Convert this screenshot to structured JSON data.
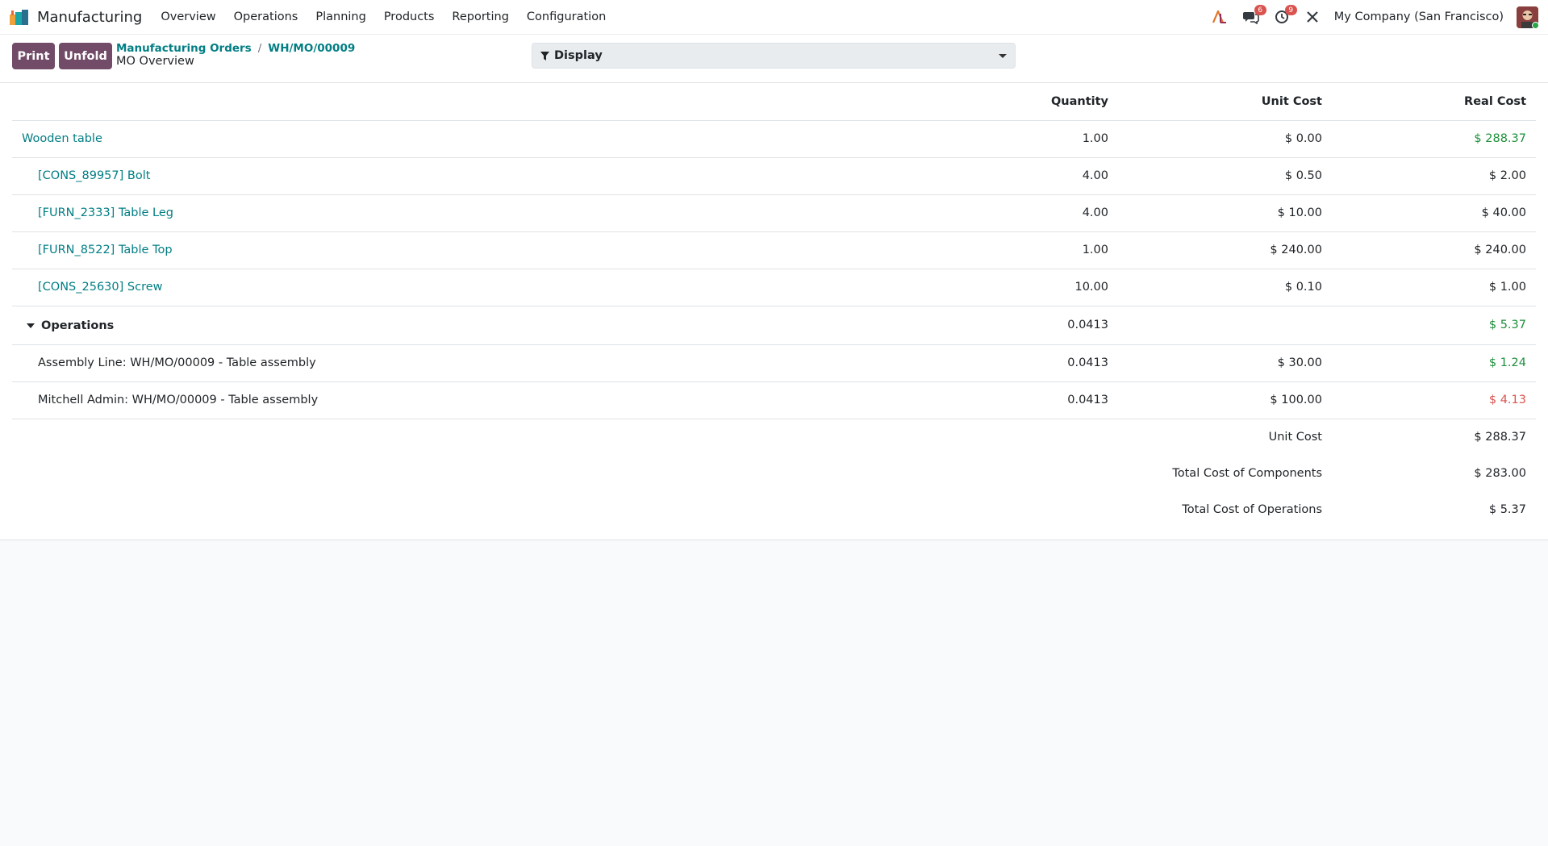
{
  "nav": {
    "app_name": "Manufacturing",
    "menu": [
      "Overview",
      "Operations",
      "Planning",
      "Products",
      "Reporting",
      "Configuration"
    ],
    "messages_badge": "6",
    "activities_badge": "9",
    "company": "My Company (San Francisco)"
  },
  "toolbar": {
    "print_label": "Print",
    "unfold_label": "Unfold",
    "breadcrumb": [
      "Manufacturing Orders",
      "WH/MO/00009"
    ],
    "breadcrumb_separator": "/",
    "title": "MO Overview",
    "display_label": "Display"
  },
  "table": {
    "headers": {
      "quantity": "Quantity",
      "unit_cost": "Unit Cost",
      "real_cost": "Real Cost"
    },
    "product": {
      "name": "Wooden table",
      "quantity": "1.00",
      "unit_cost": "$ 0.00",
      "real_cost": "$ 288.37"
    },
    "components": [
      {
        "name": "[CONS_89957] Bolt",
        "quantity": "4.00",
        "unit_cost": "$ 0.50",
        "real_cost": "$ 2.00"
      },
      {
        "name": "[FURN_2333] Table Leg",
        "quantity": "4.00",
        "unit_cost": "$ 10.00",
        "real_cost": "$ 40.00"
      },
      {
        "name": "[FURN_8522] Table Top",
        "quantity": "1.00",
        "unit_cost": "$ 240.00",
        "real_cost": "$ 240.00"
      },
      {
        "name": "[CONS_25630] Screw",
        "quantity": "10.00",
        "unit_cost": "$ 0.10",
        "real_cost": "$ 1.00"
      }
    ],
    "operations": {
      "label": "Operations",
      "quantity": "0.0413",
      "real_cost": "$ 5.37"
    },
    "operation_lines": [
      {
        "name": "Assembly Line: WH/MO/00009 - Table assembly",
        "quantity": "0.0413",
        "unit_cost": "$ 30.00",
        "real_cost": "$ 1.24"
      },
      {
        "name": "Mitchell Admin: WH/MO/00009 - Table assembly",
        "quantity": "0.0413",
        "unit_cost": "$ 100.00",
        "real_cost": "$ 4.13"
      }
    ],
    "summary": [
      {
        "label": "Unit Cost",
        "value": "$ 288.37"
      },
      {
        "label": "Total Cost of Components",
        "value": "$ 283.00"
      },
      {
        "label": "Total Cost of Operations",
        "value": "$ 5.37"
      }
    ]
  },
  "colors": {
    "brand": "#714b67",
    "link": "#017e84",
    "positive": "#1e8f3b",
    "negative": "#d9534f"
  }
}
